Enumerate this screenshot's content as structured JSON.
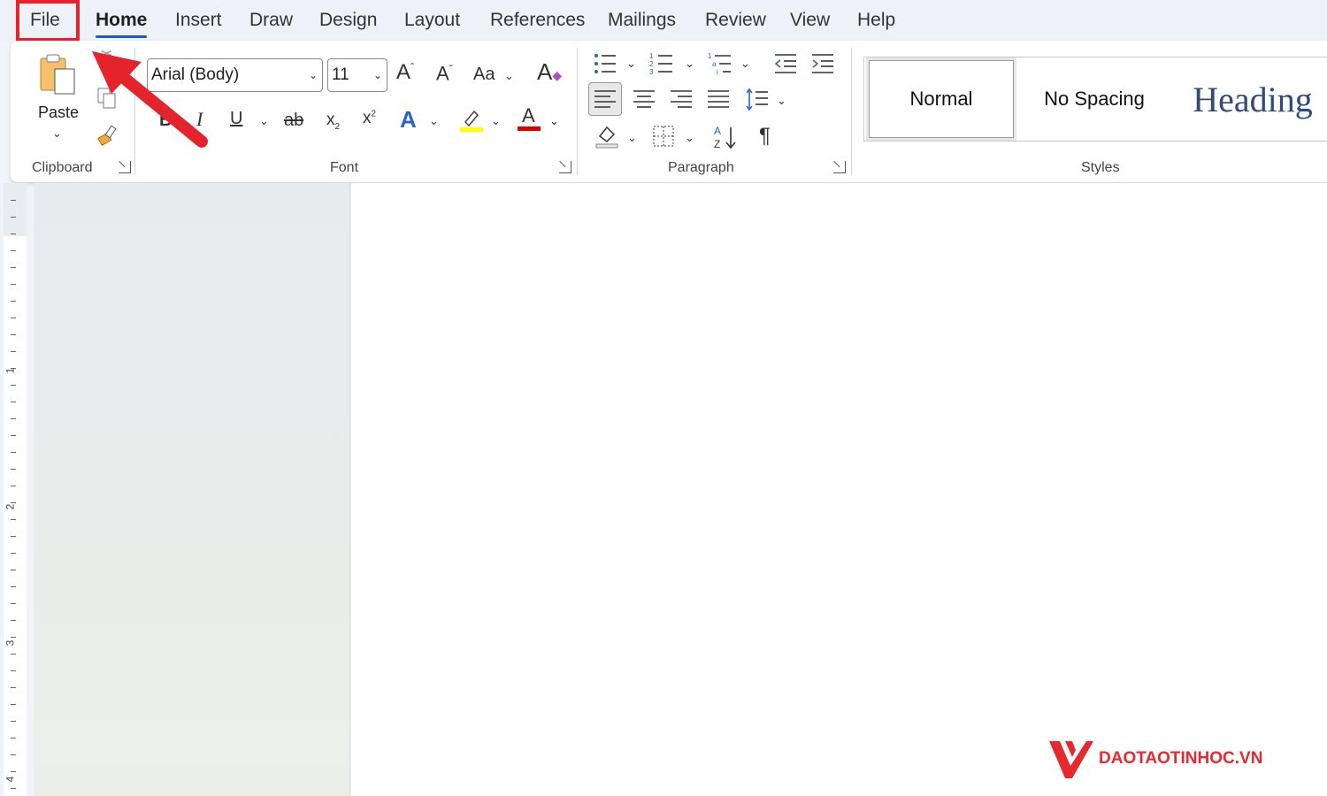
{
  "tabs": [
    {
      "label": "File"
    },
    {
      "label": "Home"
    },
    {
      "label": "Insert"
    },
    {
      "label": "Draw"
    },
    {
      "label": "Design"
    },
    {
      "label": "Layout"
    },
    {
      "label": "References"
    },
    {
      "label": "Mailings"
    },
    {
      "label": "Review"
    },
    {
      "label": "View"
    },
    {
      "label": "Help"
    }
  ],
  "active_tab": "Home",
  "highlight_color": "#e4232c",
  "clipboard": {
    "paste_label": "Paste",
    "group_label": "Clipboard"
  },
  "font": {
    "font_name": "Arial (Body)",
    "font_size": "11",
    "change_case_label": "Aa",
    "group_label": "Font",
    "highlight_color": "#ffff00",
    "font_color": "#e00000"
  },
  "paragraph": {
    "group_label": "Paragraph"
  },
  "styles": {
    "items": [
      "Normal",
      "No Spacing",
      "Heading"
    ],
    "group_label": "Styles"
  },
  "ruler": {
    "numbers": [
      "1",
      "2",
      "3",
      "4"
    ]
  },
  "watermark": {
    "text": "DAOTAOTINHOC.VN"
  }
}
